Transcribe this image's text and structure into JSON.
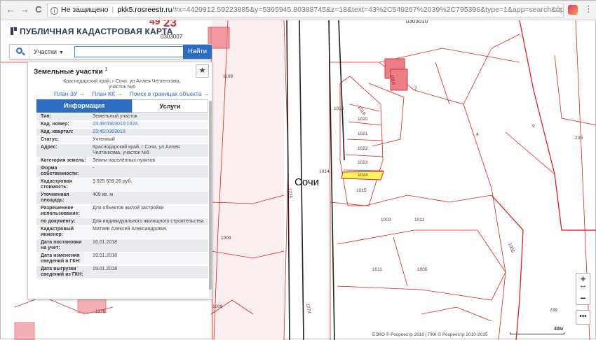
{
  "browser": {
    "back": "←",
    "forward": "→",
    "reload": "C",
    "security": "Не защищено",
    "url_host": "pkk5.rosreestr.ru",
    "url_path": "/#x=4429912.59223885&y=5395945.80388745&z=18&text=43%2C549267%2039%2C795396&type=1&app=search&opened=1",
    "star": "☆",
    "menu": "⋮"
  },
  "app": {
    "title": "ПУБЛИЧНАЯ КАДАСТРОВАЯ КАРТА"
  },
  "search": {
    "type_label": "Участки",
    "input_value": "",
    "button_label": "Найти"
  },
  "panel": {
    "title": "Земельные участки",
    "count": "1",
    "address_line1": "Краснодарский край, г Сочи, ул Аллея Челтенхэма,",
    "address_line2": "участок №6",
    "links": [
      "План ЗУ →",
      "План КК →",
      "Поиск в границах объекта →"
    ],
    "tabs": [
      "Информация",
      "Услуги"
    ],
    "rows": [
      {
        "k": "Тип:",
        "v": "Земельный участок"
      },
      {
        "k": "Кад. номер:",
        "v": "23:49:0303010:1024"
      },
      {
        "k": "Кад. квартал:",
        "v": "23:49:0303010"
      },
      {
        "k": "Статус:",
        "v": "Учтенный"
      },
      {
        "k": "Адрес:",
        "v": "Краснодарский край, г Сочи, ул Аллея Челтенхэма, участок №6"
      },
      {
        "k": "Категория земель:",
        "v": "Земли населённых пунктов"
      },
      {
        "k": "Форма собственности:",
        "v": "-"
      },
      {
        "k": "Кадастровая стоимость:",
        "v": "3 925 639,26 руб."
      },
      {
        "k": "Уточненная площадь:",
        "v": "409 кв. м"
      },
      {
        "k": "Разрешенное использование:",
        "v": "Для объектов жилой застройки"
      },
      {
        "k": "по документу:",
        "v": "Для индивидуального жилищного строительства"
      },
      {
        "k": "Кадастровый инженер:",
        "v": "Митяев Алексей Александрович"
      },
      {
        "k": "Дата постановки на учет:",
        "v": "16.01.2018"
      },
      {
        "k": "Дата изменения сведений в ГКН:",
        "v": "19.01.2018"
      },
      {
        "k": "Дата выгрузки сведений из ГКН:",
        "v": "19.01.2018"
      }
    ]
  },
  "map": {
    "city_label": "Сочи",
    "quarter_top_left": "0303007",
    "quarter_top_right": "0303010",
    "big_number": "23",
    "top_number": "49",
    "parcels": [
      "1109",
      "1016",
      "1019",
      "1020",
      "1021",
      "1022",
      "1023",
      "1024",
      "1015",
      "1014",
      "1003",
      "1011",
      "1011",
      "1005",
      "1009",
      "1009",
      "1274",
      "1274",
      "1276",
      "1010",
      "2",
      "4",
      "9",
      "239",
      "239",
      "1003",
      "1905"
    ],
    "highlight_color": "#fff45a",
    "line_color": "#e02020"
  },
  "zoom": {
    "in": "+",
    "dots": "•••",
    "out": "−",
    "more": "•••"
  },
  "footer": {
    "copyright": "ЕЭКО © Росреестр 2010 | ПКК © Росреестр 2010-2015",
    "scale": "40м"
  }
}
